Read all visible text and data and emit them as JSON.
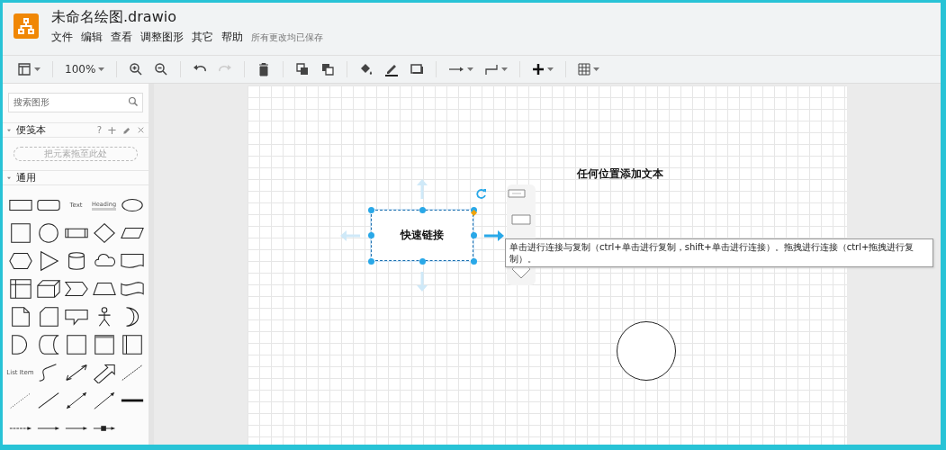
{
  "window": {
    "title": "未命名绘图.drawio"
  },
  "menu": [
    {
      "label": "文件"
    },
    {
      "label": "编辑"
    },
    {
      "label": "查看"
    },
    {
      "label": "调整图形"
    },
    {
      "label": "其它"
    },
    {
      "label": "帮助"
    }
  ],
  "save_status": "所有更改均已保存",
  "toolbar": {
    "zoom": "100%",
    "redo_disabled": true
  },
  "sidebar": {
    "search": {
      "placeholder": "搜索图形"
    },
    "scratchpad": {
      "title": "便笺本",
      "expanded": true,
      "help": "?",
      "add": "+",
      "drop_hint": "把元素拖至此处"
    },
    "general": {
      "title": "通用",
      "expanded": true,
      "labels": [
        "Text",
        "Heading",
        "List Item"
      ]
    }
  },
  "canvas": {
    "nodes": [
      {
        "kind": "rect",
        "label": "快速链接",
        "selected": true
      },
      {
        "kind": "text",
        "label": "任何位置添加文本"
      },
      {
        "kind": "ellipse"
      }
    ],
    "tooltip": "单击进行连接与复制（ctrl+单击进行复制，shift+单击进行连接）。拖拽进行连接（ctrl+拖拽进行复制）。"
  }
}
